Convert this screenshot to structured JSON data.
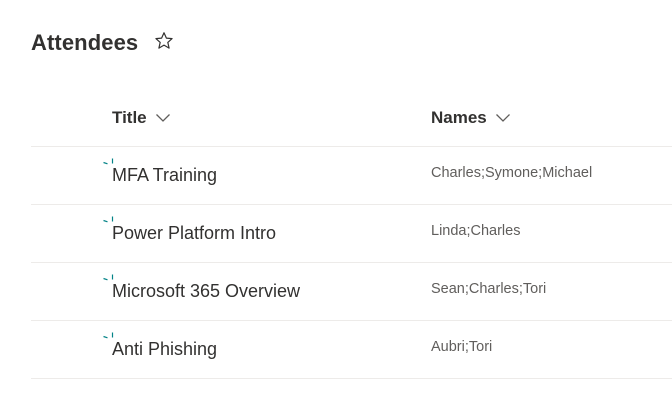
{
  "list": {
    "title": "Attendees",
    "favorite_icon": "star-outline-icon"
  },
  "columns": {
    "title": {
      "label": "Title",
      "icon": "chevron-down-icon"
    },
    "names": {
      "label": "Names",
      "icon": "chevron-down-icon"
    }
  },
  "rows": [
    {
      "title": "MFA Training",
      "names": "Charles;Symone;Michael",
      "new_icon": "new-item-indicator-icon"
    },
    {
      "title": "Power Platform Intro",
      "names": "Linda;Charles",
      "new_icon": "new-item-indicator-icon"
    },
    {
      "title": "Microsoft 365 Overview",
      "names": "Sean;Charles;Tori",
      "new_icon": "new-item-indicator-icon"
    },
    {
      "title": "Anti Phishing",
      "names": "Aubri;Tori",
      "new_icon": "new-item-indicator-icon"
    }
  ],
  "colors": {
    "new_indicator": "#038387",
    "divider": "#edebe9",
    "text_primary": "#323130",
    "text_secondary": "#605e5c"
  }
}
